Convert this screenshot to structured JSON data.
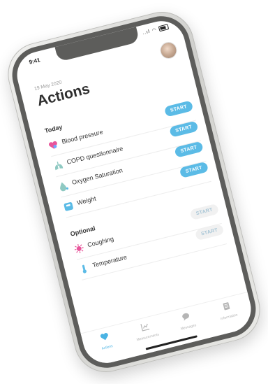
{
  "status": {
    "time": "9:41",
    "signal": "..ıl"
  },
  "header": {
    "date": "19 May 2020",
    "title": "Actions"
  },
  "sections": {
    "today": "Today",
    "optional": "Optional"
  },
  "today_items": [
    {
      "label": "Blood pressure",
      "icon": "heart-icon",
      "action": "START"
    },
    {
      "label": "COPD questionnaire",
      "icon": "lungs-icon",
      "action": "START"
    },
    {
      "label": "Oxygen Saturation",
      "icon": "oxygen-icon",
      "action": "START"
    },
    {
      "label": "Weight",
      "icon": "scale-icon",
      "action": "START"
    }
  ],
  "optional_items": [
    {
      "label": "Coughing",
      "icon": "virus-icon",
      "action": "START"
    },
    {
      "label": "Temperature",
      "icon": "thermometer-icon",
      "action": "START"
    }
  ],
  "tabs": [
    {
      "label": "Actions",
      "icon": "heart-tab-icon",
      "active": true
    },
    {
      "label": "Measurements",
      "icon": "chart-tab-icon",
      "active": false
    },
    {
      "label": "Messages",
      "icon": "chat-tab-icon",
      "active": false
    },
    {
      "label": "Information",
      "icon": "doc-tab-icon",
      "active": false
    }
  ],
  "colors": {
    "accent": "#5bbbe6",
    "pink": "#e8559b",
    "teal": "#8fc9c2"
  }
}
